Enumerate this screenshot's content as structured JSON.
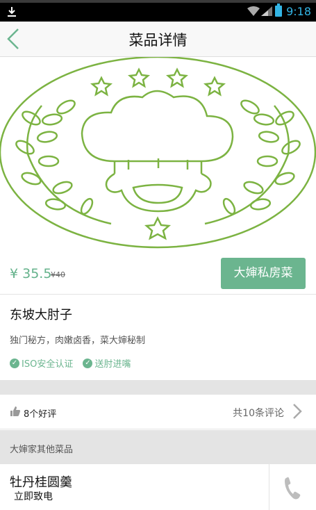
{
  "status_bar": {
    "time": "9:18"
  },
  "header": {
    "title": "菜品详情"
  },
  "price": {
    "current": "¥ 35.5",
    "original": "¥40"
  },
  "chef_button": {
    "label": "大婶私房菜"
  },
  "dish": {
    "name": "东坡大肘子",
    "description": "独门秘方，肉嫩卤香，菜大婶秘制",
    "badges": [
      "ISO安全认证",
      "送肘进嘴"
    ]
  },
  "reviews": {
    "good_count": "8个好评",
    "total_label": "共10条评论"
  },
  "other_section": {
    "header": "大婶家其他菜品"
  },
  "other_dish": {
    "name": "牡丹桂圆羹",
    "call_label": "立即致电"
  },
  "colors": {
    "accent": "#6bb58f",
    "logo_green": "#7cb342"
  },
  "icons": [
    "download-icon",
    "wifi-icon",
    "signal-icon",
    "battery-icon",
    "back-arrow-icon",
    "chef-logo",
    "check-icon",
    "thumbs-up-icon",
    "chevron-right-icon",
    "phone-icon"
  ]
}
